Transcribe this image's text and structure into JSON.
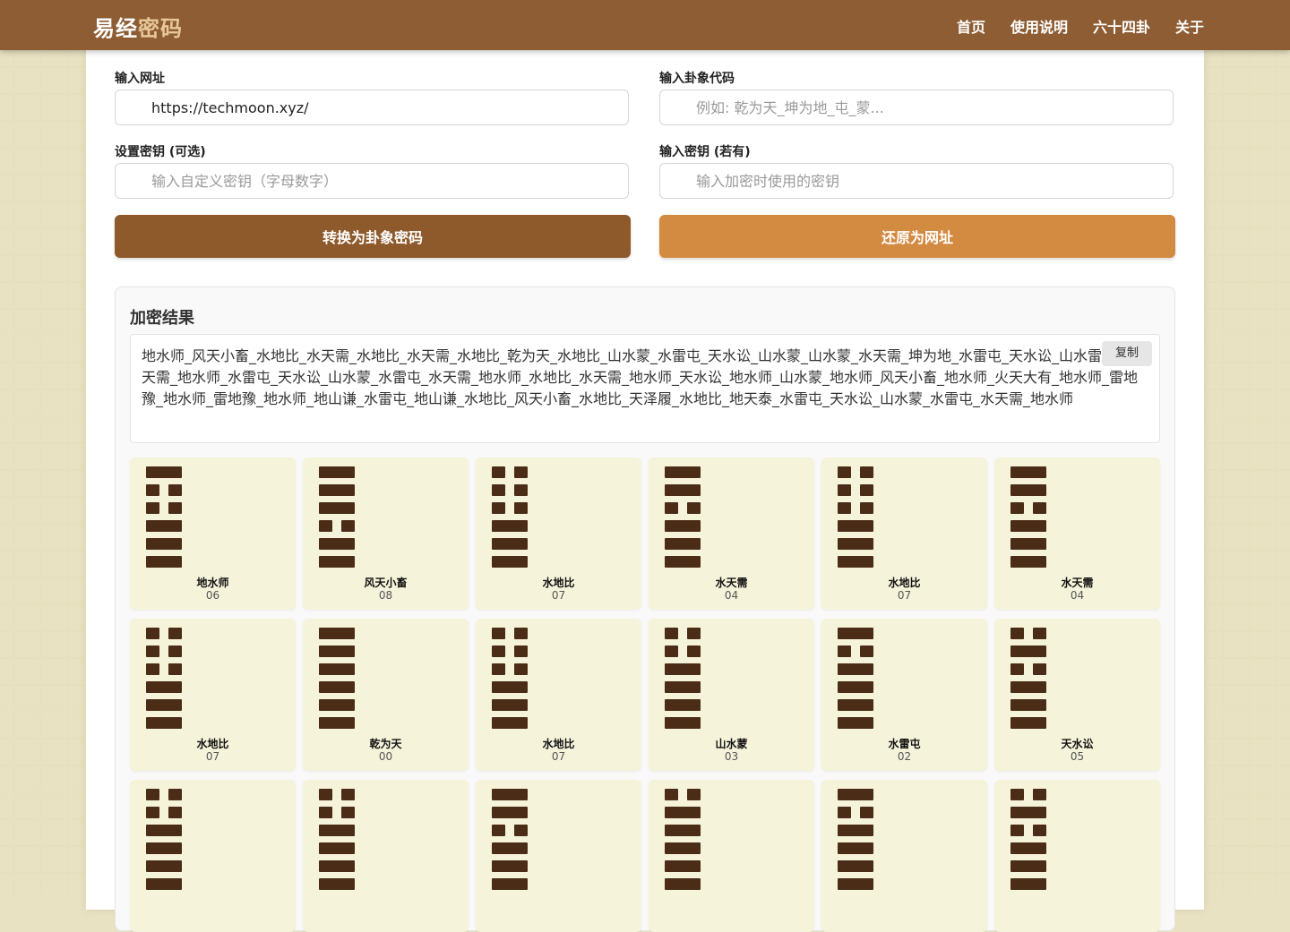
{
  "brand": {
    "part1": "易经",
    "part2": "密码"
  },
  "nav": [
    "首页",
    "使用说明",
    "六十四卦",
    "关于"
  ],
  "form": {
    "url_label": "输入网址",
    "url_value": "https://techmoon.xyz/",
    "code_label": "输入卦象代码",
    "code_placeholder": "例如: 乾为天_坤为地_屯_蒙...",
    "key_label": "设置密钥 (可选)",
    "key_placeholder": "输入自定义密钥（字母数字）",
    "dkey_label": "输入密钥 (若有)",
    "dkey_placeholder": "输入加密时使用的密钥",
    "encode_button": "转换为卦象密码",
    "decode_button": "还原为网址"
  },
  "result": {
    "title": "加密结果",
    "copy": "复制",
    "text": "地水师_风天小畜_水地比_水天需_水地比_水天需_水地比_乾为天_水地比_山水蒙_水雷屯_天水讼_山水蒙_山水蒙_水天需_坤为地_水雷屯_天水讼_山水雷屯_水天需_地水师_水雷屯_天水讼_山水蒙_水雷屯_水天需_地水师_水地比_水天需_地水师_天水讼_地水师_山水蒙_地水师_风天小畜_地水师_火天大有_地水师_雷地豫_地水师_雷地豫_地水师_地山谦_水雷屯_地山谦_水地比_风天小畜_水地比_天泽履_水地比_地天泰_水雷屯_天水讼_山水蒙_水雷屯_水天需_地水师"
  },
  "hexagrams": [
    {
      "name": "地水师",
      "code": "06",
      "lines": [
        0,
        1,
        1,
        0,
        0,
        0
      ]
    },
    {
      "name": "风天小畜",
      "code": "08",
      "lines": [
        0,
        0,
        0,
        1,
        0,
        0
      ]
    },
    {
      "name": "水地比",
      "code": "07",
      "lines": [
        1,
        1,
        1,
        0,
        0,
        0
      ]
    },
    {
      "name": "水天需",
      "code": "04",
      "lines": [
        0,
        0,
        1,
        0,
        0,
        0
      ]
    },
    {
      "name": "水地比",
      "code": "07",
      "lines": [
        1,
        1,
        1,
        0,
        0,
        0
      ]
    },
    {
      "name": "水天需",
      "code": "04",
      "lines": [
        0,
        0,
        1,
        0,
        0,
        0
      ]
    },
    {
      "name": "水地比",
      "code": "07",
      "lines": [
        1,
        1,
        1,
        0,
        0,
        0
      ]
    },
    {
      "name": "乾为天",
      "code": "00",
      "lines": [
        0,
        0,
        0,
        0,
        0,
        0
      ]
    },
    {
      "name": "水地比",
      "code": "07",
      "lines": [
        1,
        1,
        1,
        0,
        0,
        0
      ]
    },
    {
      "name": "山水蒙",
      "code": "03",
      "lines": [
        1,
        1,
        0,
        0,
        0,
        0
      ]
    },
    {
      "name": "水雷屯",
      "code": "02",
      "lines": [
        0,
        1,
        0,
        0,
        0,
        0
      ]
    },
    {
      "name": "天水讼",
      "code": "05",
      "lines": [
        1,
        0,
        1,
        0,
        0,
        0
      ]
    },
    {
      "name": "",
      "code": "",
      "lines": [
        1,
        1,
        0,
        0,
        0,
        0
      ]
    },
    {
      "name": "",
      "code": "",
      "lines": [
        1,
        1,
        0,
        0,
        0,
        0
      ]
    },
    {
      "name": "",
      "code": "",
      "lines": [
        0,
        0,
        1,
        0,
        0,
        0
      ]
    },
    {
      "name": "",
      "code": "",
      "lines": [
        1,
        0,
        0,
        0,
        0,
        0
      ]
    },
    {
      "name": "",
      "code": "",
      "lines": [
        0,
        1,
        0,
        0,
        0,
        0
      ]
    },
    {
      "name": "",
      "code": "",
      "lines": [
        1,
        0,
        1,
        0,
        0,
        0
      ]
    }
  ]
}
